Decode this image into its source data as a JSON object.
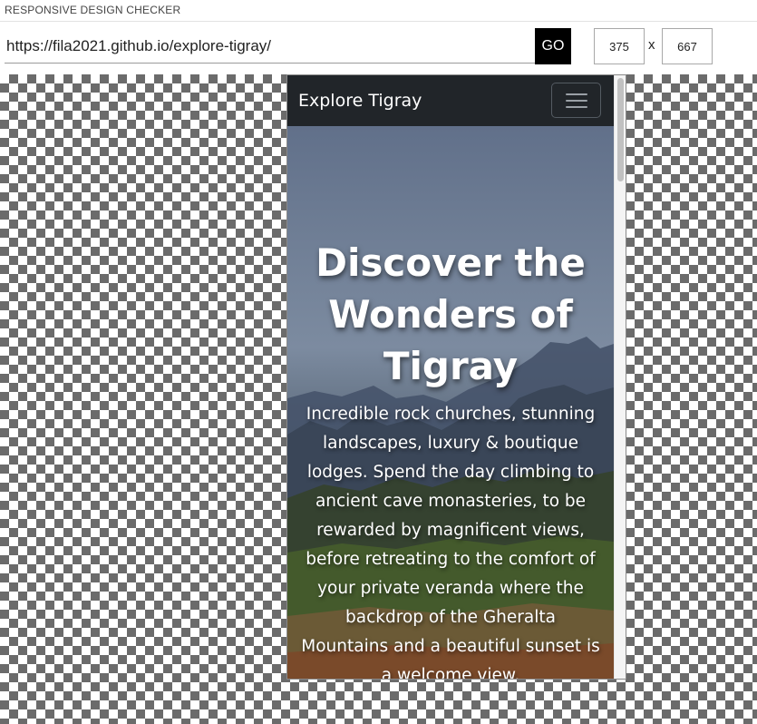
{
  "app": {
    "title": "RESPONSIVE DESIGN CHECKER"
  },
  "toolbar": {
    "url": "https://fila2021.github.io/explore-tigray/",
    "go_label": "GO",
    "width_value": "375",
    "height_value": "667",
    "separator": "x"
  },
  "site": {
    "brand": "Explore Tigray",
    "menu_icon": "hamburger-icon",
    "hero_title": "Discover the Wonders of Tigray",
    "hero_text": "Incredible rock churches, stunning landscapes, luxury & boutique lodges. Spend the day climbing to ancient cave monasteries, to be rewarded by magnificent views, before retreating to the comfort of your private veranda where the backdrop of the Gheralta Mountains and a beautiful sunset is a welcome view."
  },
  "colors": {
    "navbar": "#212529",
    "go_button": "#000000",
    "checker": "#6b6b6b"
  }
}
